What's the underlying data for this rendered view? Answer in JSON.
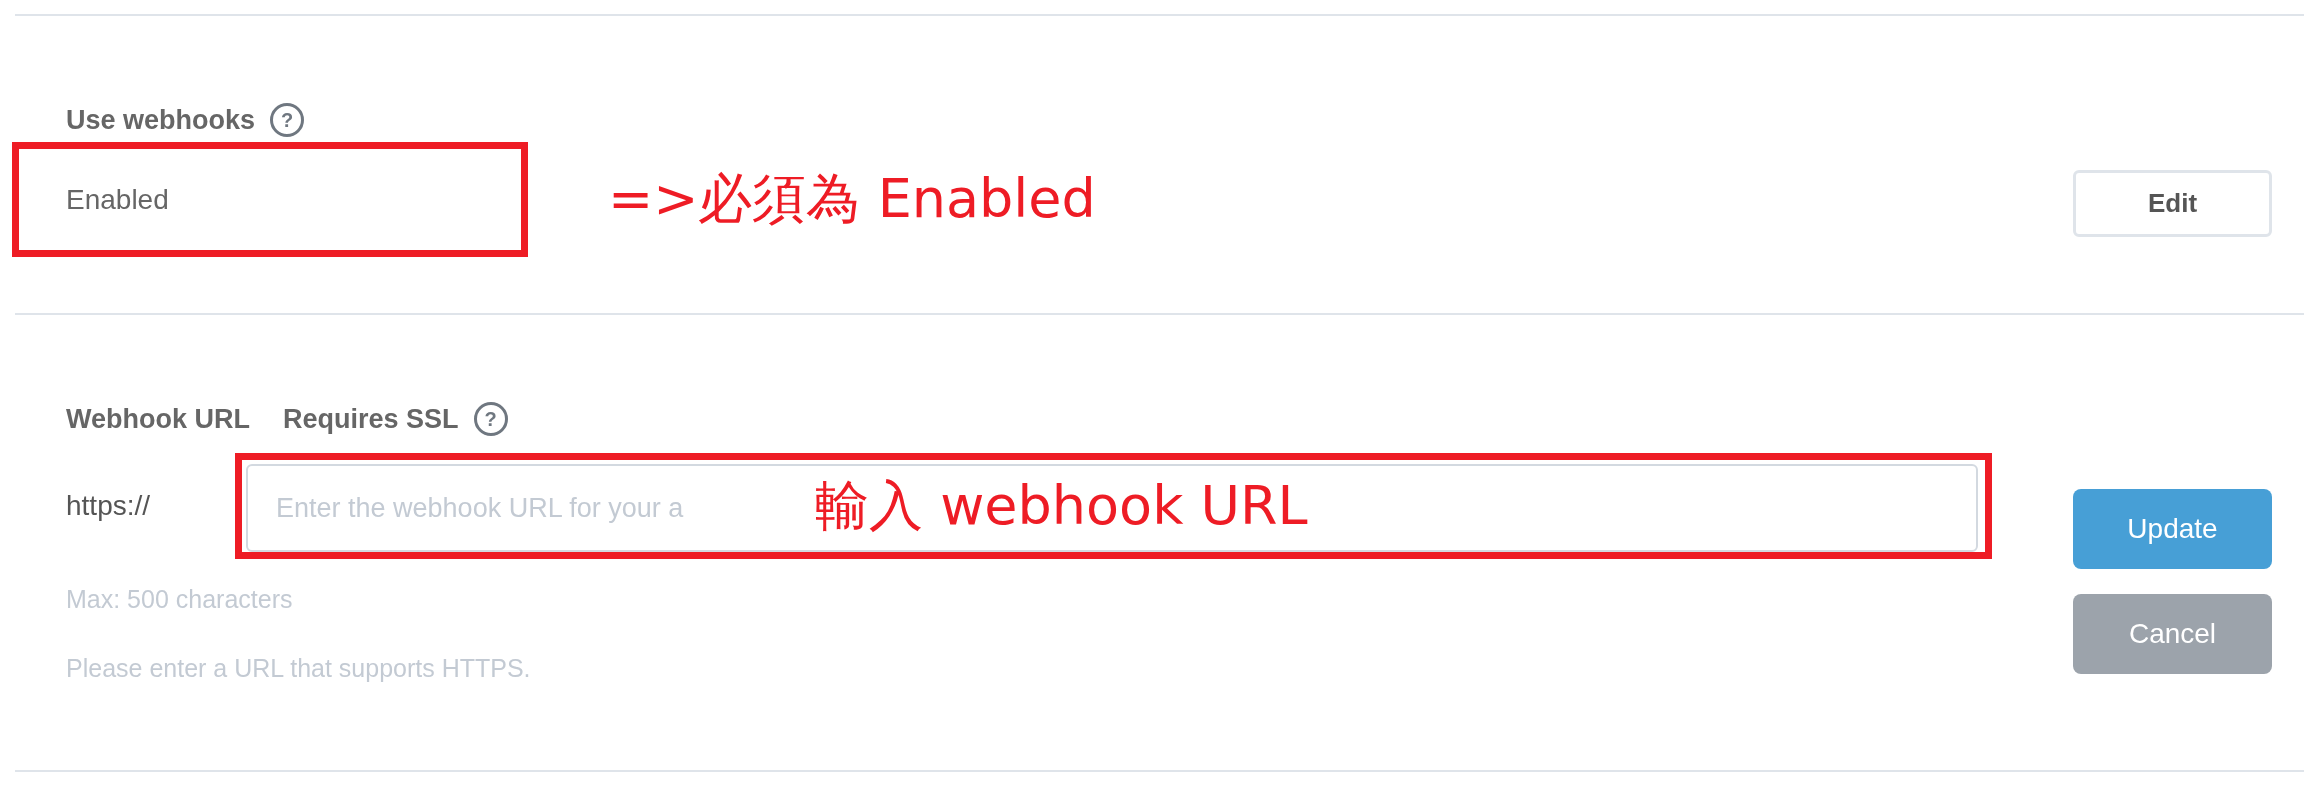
{
  "use_webhooks": {
    "label": "Use webhooks",
    "help_icon": "?",
    "value": "Enabled",
    "edit_button": "Edit"
  },
  "webhook_url": {
    "label": "Webhook URL",
    "requirement": "Requires SSL",
    "help_icon": "?",
    "prefix": "https://",
    "placeholder": "Enter the webhook URL for your a",
    "hints": [
      "Max: 500 characters",
      "Please enter a URL that supports HTTPS."
    ],
    "buttons": [
      {
        "label": "Update",
        "kind": "primary"
      },
      {
        "label": "Cancel",
        "kind": "secondary"
      }
    ]
  },
  "annotations": [
    {
      "text": "=>必須為 Enabled"
    },
    {
      "text": "輸入 webhook URL"
    }
  ]
}
